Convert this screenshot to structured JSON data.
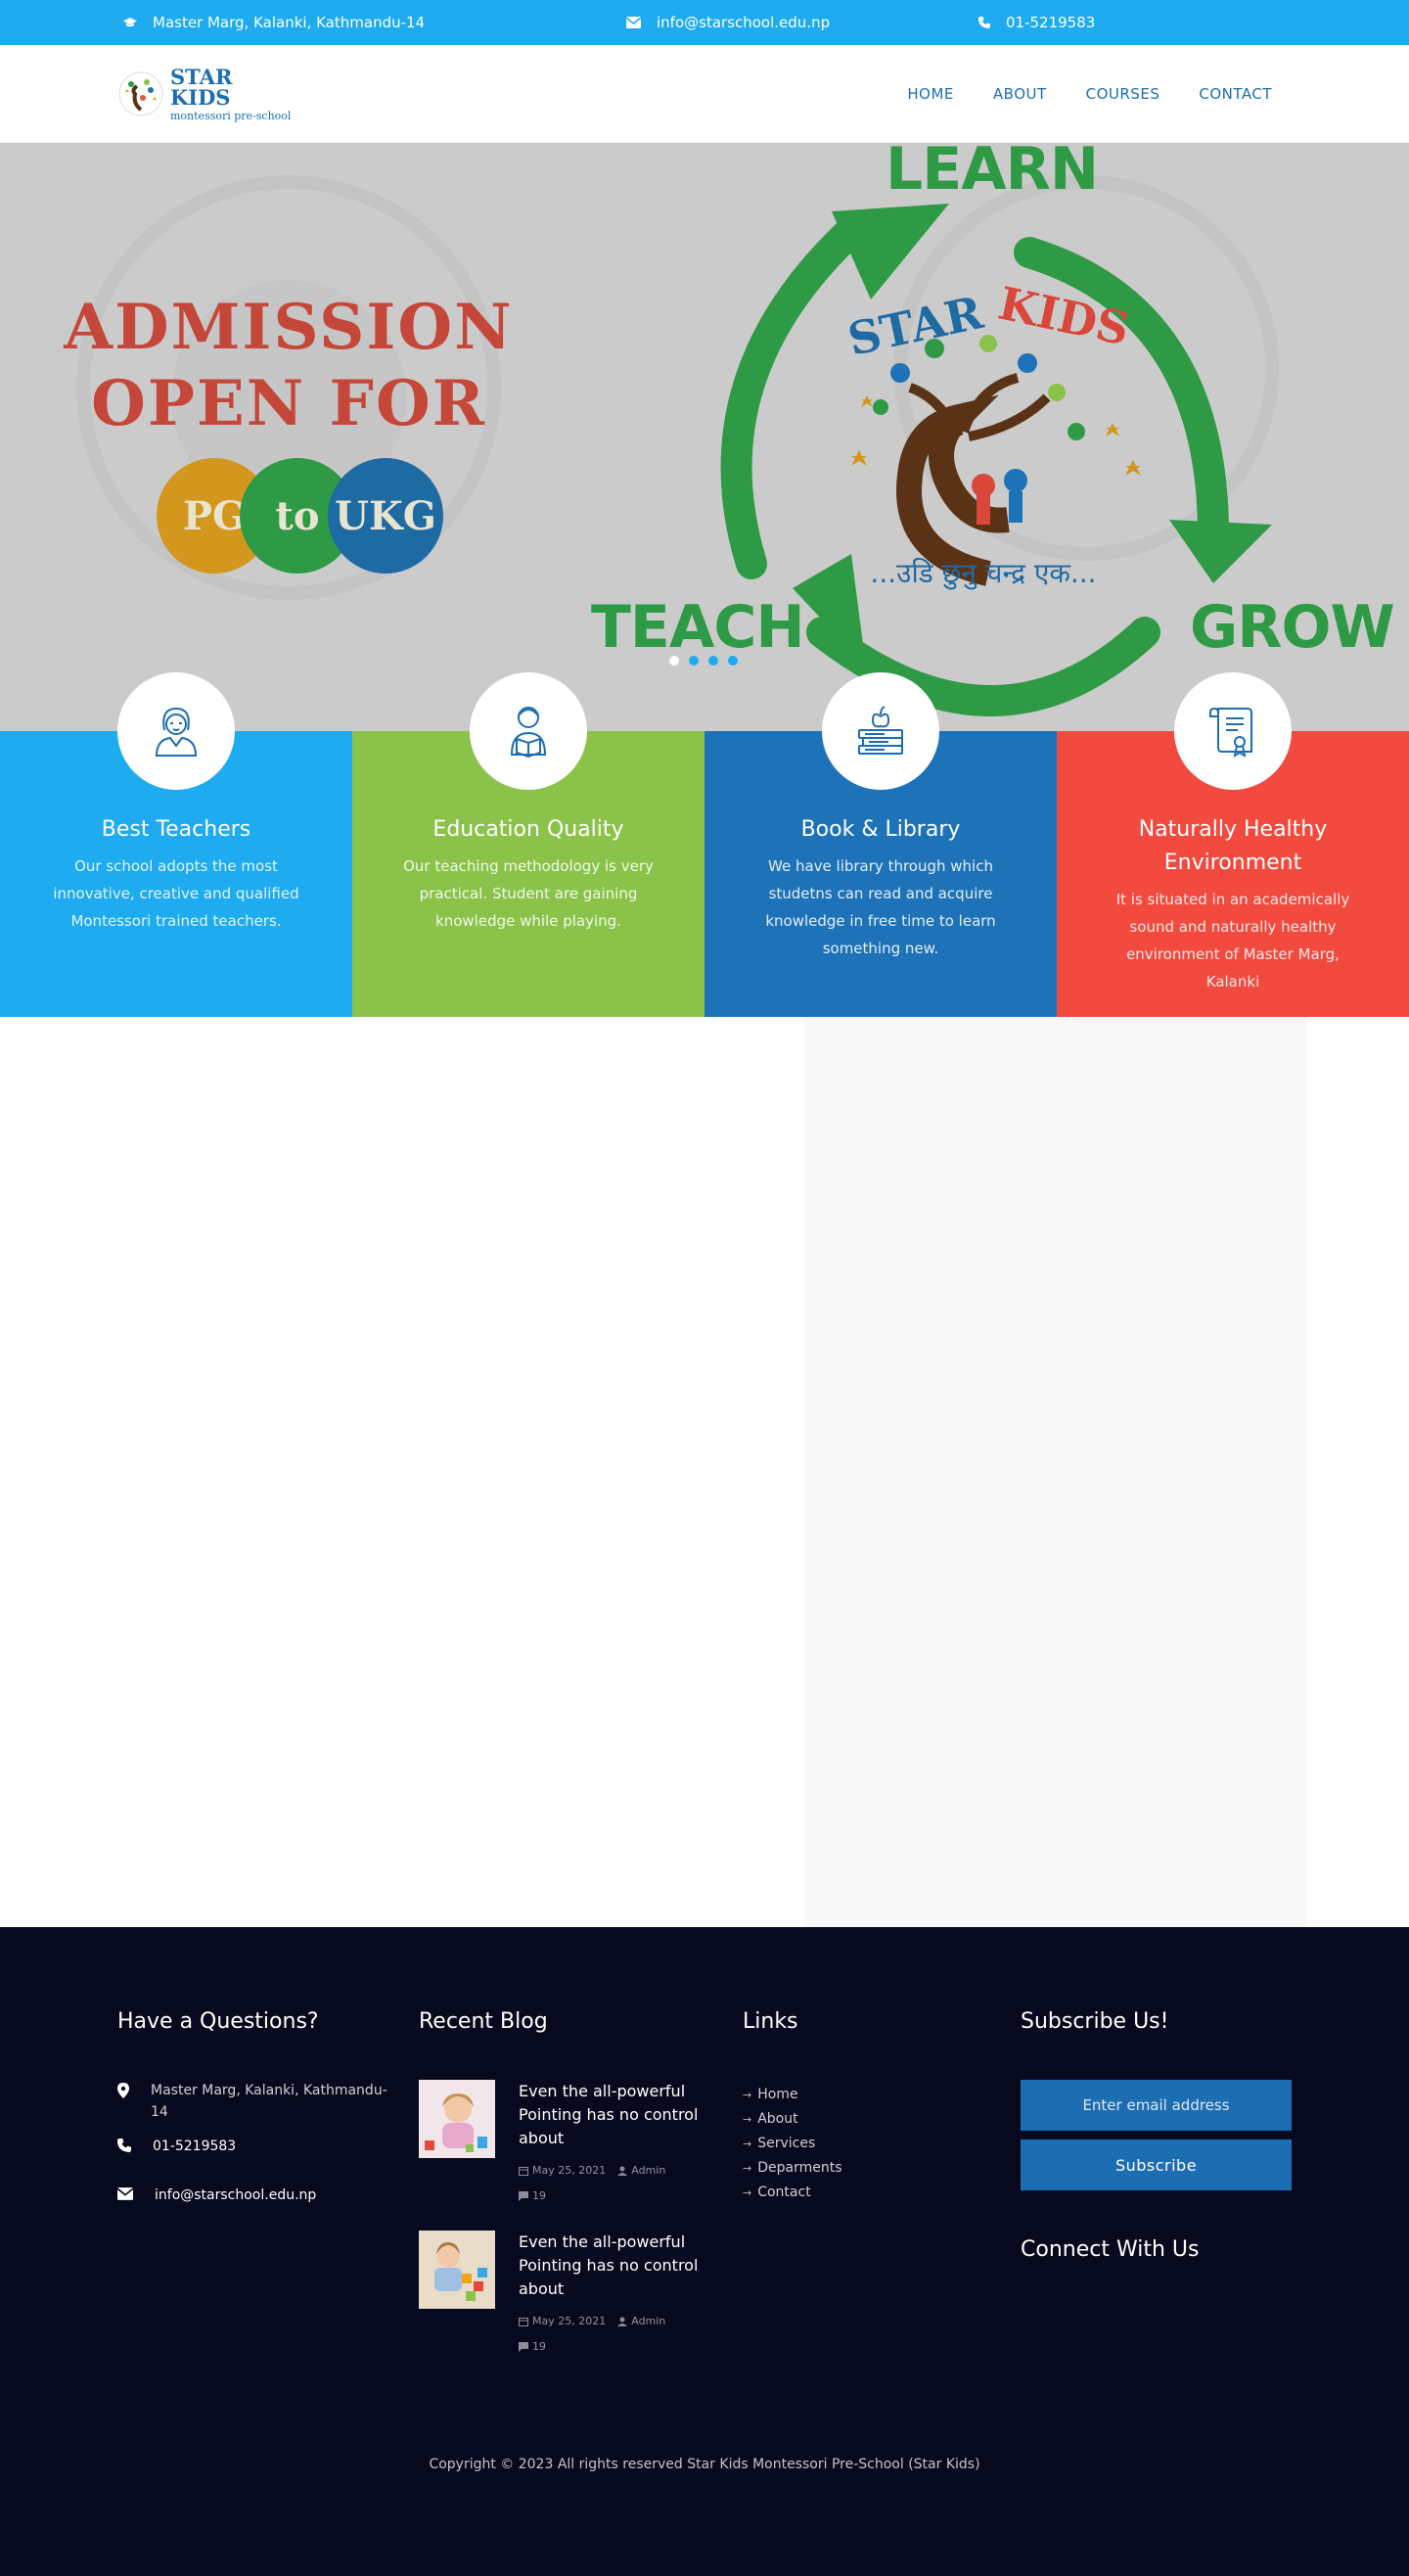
{
  "topbar": {
    "address": "Master Marg, Kalanki, Kathmandu-14",
    "email": "info@starschool.edu.np",
    "phone": "01-5219583"
  },
  "header": {
    "logo_title": "STAR KIDS",
    "logo_subtitle": "montessori pre-school",
    "nav": [
      "HOME",
      "ABOUT",
      "COURSES",
      "CONTACT"
    ]
  },
  "hero": {
    "headline_line1": "ADMISSION",
    "headline_line2": "OPEN FOR",
    "badges": [
      "PG",
      "to",
      "UKG"
    ],
    "word_learn": "LEARN",
    "word_teach": "TEACH",
    "word_grow": "GROW",
    "logo_star": "STAR",
    "logo_kids": "KIDS",
    "logo_tagline": "...उडि छुनु चन्द्र एक...",
    "slides": 4,
    "active_slide": 1
  },
  "features": [
    {
      "title": "Best Teachers",
      "text": "Our school adopts the most innovative, creative and qualified Montessori trained teachers.",
      "color": "#1eabf0",
      "icon": "teacher-icon"
    },
    {
      "title": "Education Quality",
      "text": "Our teaching methodology is very practical. Student are gaining knowledge while playing.",
      "color": "#8bc34a",
      "icon": "student-reading-icon"
    },
    {
      "title": "Book & Library",
      "text": "We have library through which studetns can read and acquire knowledge in free time to learn something new.",
      "color": "#1e73b8",
      "icon": "books-apple-icon"
    },
    {
      "title": "Naturally Healthy Environment",
      "text": "It is situated in an academically sound and naturally healthy environment of Master Marg, Kalanki",
      "color": "#f24a3f",
      "icon": "certificate-icon"
    }
  ],
  "footer": {
    "questions_title": "Have a Questions?",
    "address": "Master Marg, Kalanki, Kathmandu-14",
    "phone": "01-5219583",
    "email": "info@starschool.edu.np",
    "blog_title": "Recent Blog",
    "posts": [
      {
        "title": "Even the all-powerful Pointing has no control about",
        "date": "May 25, 2021",
        "author": "Admin",
        "comments": "19"
      },
      {
        "title": "Even the all-powerful Pointing has no control about",
        "date": "May 25, 2021",
        "author": "Admin",
        "comments": "19"
      }
    ],
    "links_title": "Links",
    "links": [
      "Home",
      "About",
      "Services",
      "Deparments",
      "Contact"
    ],
    "subscribe_title": "Subscribe Us!",
    "subscribe_placeholder": "Enter email address",
    "subscribe_button": "Subscribe",
    "connect_title": "Connect With Us",
    "copyright": "Copyright © 2023 All rights reserved Star Kids Montessori Pre-School (Star Kids)"
  },
  "colors": {
    "primary_blue": "#1eabf0",
    "dark_blue": "#1d6db2",
    "green": "#8bc34a",
    "red": "#f24a3f",
    "footer_bg": "#070a1e"
  }
}
